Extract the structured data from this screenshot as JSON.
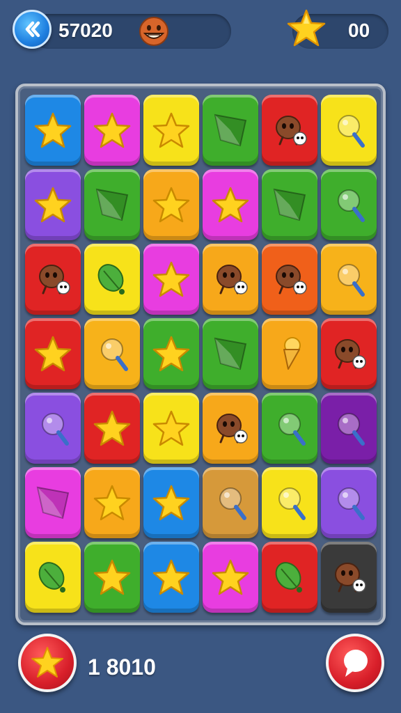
{
  "header": {
    "score": "57020",
    "stars": "00",
    "back_icon": "back-arrow-icon",
    "face_icon": "grinning-face-icon",
    "star_icon": "star-icon"
  },
  "board": {
    "columns": 6,
    "rows": 7,
    "tiles": [
      {
        "color": "#1e88e5",
        "icon": "star"
      },
      {
        "color": "#e83de0",
        "icon": "star"
      },
      {
        "color": "#f7e21a",
        "icon": "star"
      },
      {
        "color": "#3fae2c",
        "icon": "kite"
      },
      {
        "color": "#e02424",
        "icon": "creature"
      },
      {
        "color": "#f7e21a",
        "icon": "lollipop"
      },
      {
        "color": "#8a4fe0",
        "icon": "star"
      },
      {
        "color": "#3fae2c",
        "icon": "kite"
      },
      {
        "color": "#f7a81a",
        "icon": "star"
      },
      {
        "color": "#e83de0",
        "icon": "star"
      },
      {
        "color": "#3fae2c",
        "icon": "kite"
      },
      {
        "color": "#3fae2c",
        "icon": "lollipop"
      },
      {
        "color": "#e02424",
        "icon": "creature"
      },
      {
        "color": "#f7e21a",
        "icon": "leaf"
      },
      {
        "color": "#e83de0",
        "icon": "star"
      },
      {
        "color": "#f7a81a",
        "icon": "creature"
      },
      {
        "color": "#f0601a",
        "icon": "creature"
      },
      {
        "color": "#f7b21a",
        "icon": "lollipop"
      },
      {
        "color": "#e02424",
        "icon": "star"
      },
      {
        "color": "#f7b21a",
        "icon": "lollipop"
      },
      {
        "color": "#3fae2c",
        "icon": "star"
      },
      {
        "color": "#3fae2c",
        "icon": "kite"
      },
      {
        "color": "#f7a81a",
        "icon": "ice-cream"
      },
      {
        "color": "#e02424",
        "icon": "creature"
      },
      {
        "color": "#8a4fe0",
        "icon": "lollipop"
      },
      {
        "color": "#e02424",
        "icon": "star"
      },
      {
        "color": "#f7e21a",
        "icon": "star"
      },
      {
        "color": "#f7a81a",
        "icon": "creature"
      },
      {
        "color": "#3fae2c",
        "icon": "lollipop"
      },
      {
        "color": "#7a1fa8",
        "icon": "lollipop"
      },
      {
        "color": "#e83de0",
        "icon": "kite"
      },
      {
        "color": "#f7a81a",
        "icon": "star"
      },
      {
        "color": "#1e88e5",
        "icon": "star"
      },
      {
        "color": "#d6993a",
        "icon": "lollipop"
      },
      {
        "color": "#f7e21a",
        "icon": "lollipop"
      },
      {
        "color": "#8a4fe0",
        "icon": "lollipop"
      },
      {
        "color": "#f7e21a",
        "icon": "leaf"
      },
      {
        "color": "#3fae2c",
        "icon": "star"
      },
      {
        "color": "#1e88e5",
        "icon": "star"
      },
      {
        "color": "#e83de0",
        "icon": "star"
      },
      {
        "color": "#e02424",
        "icon": "leaf"
      },
      {
        "color": "#3a3a3a",
        "icon": "creature"
      }
    ]
  },
  "footer": {
    "moves": "1 8010",
    "star_button_icon": "star-icon",
    "chat_button_icon": "chat-bubble-icon",
    "button_color": "#d81f2a"
  }
}
